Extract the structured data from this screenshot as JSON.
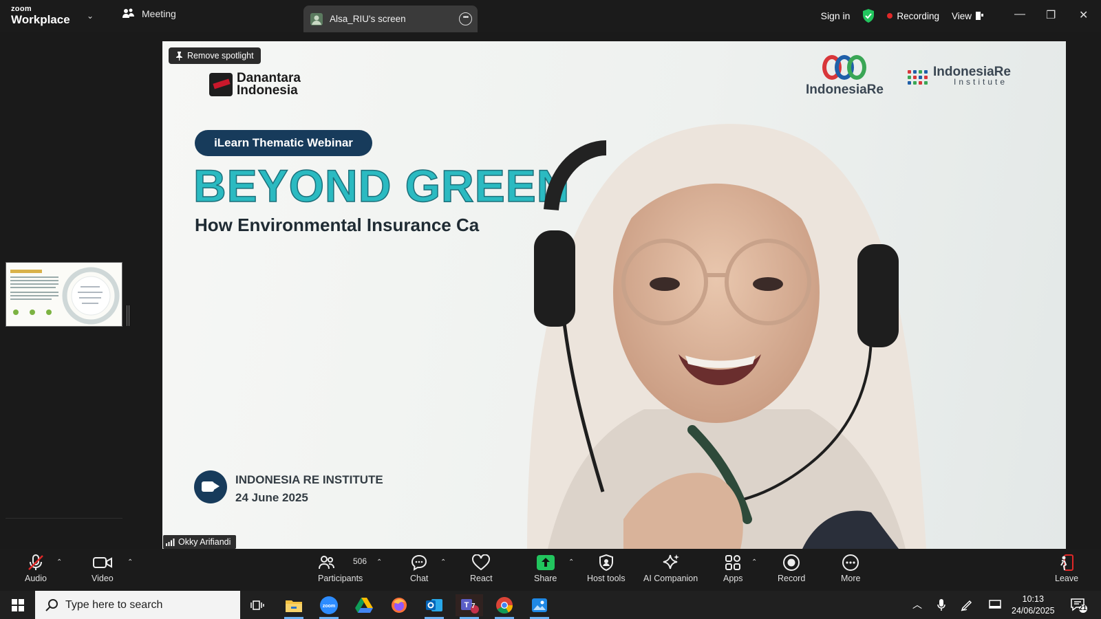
{
  "titlebar": {
    "brand_top": "zoom",
    "brand_bottom": "Workplace",
    "meeting_tab": "Meeting",
    "screen_tab": "Alsa_RIU's screen",
    "sign_in": "Sign in",
    "recording": "Recording",
    "view": "View"
  },
  "stage": {
    "spotlight_button": "Remove spotlight",
    "name_tag": "Okky Arifiandi",
    "slide": {
      "logo_left_line1": "Danantara",
      "logo_left_line2": "Indonesia",
      "logo_mid": "IndonesiaRe",
      "logo_right_main": "IndonesiaRe",
      "logo_right_sub": "Institute",
      "pill": "iLearn Thematic Webinar",
      "headline": "BEYOND GREEN",
      "subheadline": "How Environmental Insurance Ca",
      "org": "INDONESIA RE INSTITUTE",
      "date": "24 June 2025"
    }
  },
  "toolbar": {
    "audio": "Audio",
    "video": "Video",
    "participants": "Participants",
    "participants_count": "506",
    "chat": "Chat",
    "react": "React",
    "share": "Share",
    "host_tools": "Host tools",
    "ai_companion": "AI Companion",
    "apps": "Apps",
    "record": "Record",
    "more": "More",
    "leave": "Leave"
  },
  "taskbar": {
    "search_placeholder": "Type here to search",
    "time": "10:13",
    "date": "24/06/2025",
    "notification_count": "21",
    "teams_badge": "7"
  },
  "colors": {
    "accent_green": "#22c55e",
    "record_red": "#e02828",
    "headline_teal": "#2bbac1",
    "pill_navy": "#173b5b"
  }
}
